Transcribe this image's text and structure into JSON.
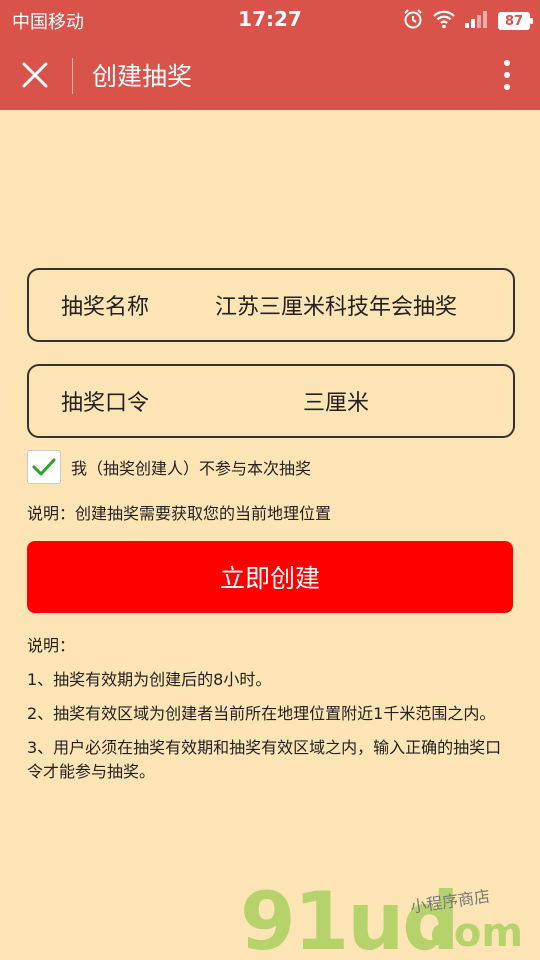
{
  "status": {
    "carrier": "中国移动",
    "time": "17:27",
    "battery": "87"
  },
  "header": {
    "title": "创建抽奖"
  },
  "form": {
    "name_label": "抽奖名称",
    "name_value": "江苏三厘米科技年会抽奖",
    "code_label": "抽奖口令",
    "code_value": "三厘米",
    "agree_text": "我（抽奖创建人）不参与本次抽奖",
    "note": "说明：创建抽奖需要获取您的当前地理位置",
    "create_label": "立即创建"
  },
  "info": {
    "heading": "说明：",
    "items": [
      "1、抽奖有效期为创建后的8小时。",
      "2、抽奖有效区域为创建者当前所在地理位置附近1千米范围之内。",
      "3、用户必须在抽奖有效期和抽奖有效区域之内，输入正确的抽奖口令才能参与抽奖。"
    ]
  },
  "watermark": {
    "logo": "91ud",
    "domain": ".com",
    "tagline": "小程序商店"
  },
  "colors": {
    "header": "#d9534a",
    "background": "#fde4b4",
    "button": "#ff0000",
    "check": "#2aa52a"
  }
}
